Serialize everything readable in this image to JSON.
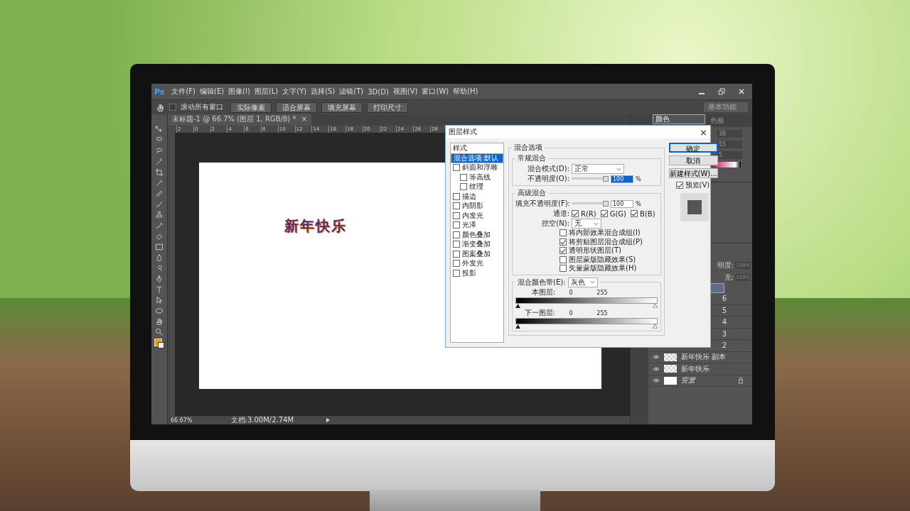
{
  "menubar": {
    "logo": "Ps",
    "menus": [
      "文件(F)",
      "编辑(E)",
      "图像(I)",
      "图层(L)",
      "文字(Y)",
      "选择(S)",
      "滤镜(T)",
      "3D(D)",
      "视图(V)",
      "窗口(W)",
      "帮助(H)"
    ]
  },
  "options_bar": {
    "scroll_all": {
      "label": "滚动所有窗口",
      "checked": false
    },
    "buttons": [
      "实际像素",
      "适合屏幕",
      "填充屏幕",
      "打印尺寸"
    ],
    "workspace": "基本功能"
  },
  "document": {
    "tab": "未标题-1 @ 66.7% (图层 1, RGB/8) *",
    "tab_close": "×",
    "ruler_labels": [
      "2",
      "0",
      "2",
      "4",
      "6",
      "8",
      "10",
      "12",
      "14",
      "16",
      "18",
      "20",
      "22",
      "24",
      "26",
      "28"
    ],
    "canvas_text": "新年快乐",
    "status": {
      "zoom": "66.67%",
      "doc_size": "文档:3.00M/2.74M"
    }
  },
  "panels": {
    "color_tabs": [
      {
        "label": "颜色",
        "selected": true
      },
      {
        "label": "色板",
        "selected": false
      }
    ],
    "color_values": [
      "38",
      "55",
      "5"
    ],
    "layers": {
      "opacity_label": "明度:",
      "opacity": "100%",
      "fill_label": "充:",
      "fill": "100%",
      "rows": [
        {
          "kind": "covered",
          "selected": true
        },
        {
          "kind": "covered",
          "name": "6",
          "selected": false
        },
        {
          "kind": "covered",
          "name": "5",
          "selected": false
        },
        {
          "kind": "covered",
          "name": "4",
          "selected": false
        },
        {
          "kind": "covered",
          "name": "3",
          "selected": false
        },
        {
          "kind": "covered",
          "name": "2",
          "selected": false
        },
        {
          "kind": "full",
          "name": "新年快乐 副本",
          "selected": false,
          "visible": true,
          "locked": false,
          "transparent": true
        },
        {
          "kind": "full",
          "name": "新年快乐",
          "selected": false,
          "visible": true,
          "locked": false,
          "transparent": true
        },
        {
          "kind": "full",
          "name": "背景",
          "selected": false,
          "visible": true,
          "locked": true,
          "transparent": false
        }
      ]
    }
  },
  "dialog": {
    "title": "图层样式",
    "close": "×",
    "styles_header": "样式",
    "styles": [
      {
        "label": "混合选项:默认",
        "kind": "plain",
        "selected": true
      },
      {
        "label": "斜面和浮雕",
        "kind": "check",
        "checked": false,
        "selected": false,
        "children": [
          {
            "label": "等高线",
            "kind": "check",
            "checked": false,
            "selected": false
          },
          {
            "label": "纹理",
            "kind": "check",
            "checked": false,
            "selected": false
          }
        ]
      },
      {
        "label": "描边",
        "kind": "check",
        "checked": false,
        "selected": false
      },
      {
        "label": "内阴影",
        "kind": "check",
        "checked": false,
        "selected": false
      },
      {
        "label": "内发光",
        "kind": "check",
        "checked": false,
        "selected": false
      },
      {
        "label": "光泽",
        "kind": "check",
        "checked": false,
        "selected": false
      },
      {
        "label": "颜色叠加",
        "kind": "check",
        "checked": false,
        "selected": false
      },
      {
        "label": "渐变叠加",
        "kind": "check",
        "checked": false,
        "selected": false
      },
      {
        "label": "图案叠加",
        "kind": "check",
        "checked": false,
        "selected": false
      },
      {
        "label": "外发光",
        "kind": "check",
        "checked": false,
        "selected": false
      },
      {
        "label": "投影",
        "kind": "check",
        "checked": false,
        "selected": false
      }
    ],
    "blend_options": {
      "title": "混合选项",
      "general": {
        "title": "常规混合",
        "mode_label": "混合模式(D):",
        "mode": "正常",
        "opacity": {
          "label": "不透明度(O):",
          "level": 1,
          "value": "100",
          "highlighted": true,
          "unit": "%"
        }
      },
      "advanced": {
        "title": "高级混合",
        "fill": {
          "label": "填充不透明度(F):",
          "level": 1,
          "value": "100",
          "highlighted": false,
          "unit": "%"
        },
        "channels_label": "通道:",
        "channels": [
          {
            "label": "R(R)",
            "checked": true
          },
          {
            "label": "G(G)",
            "checked": true
          },
          {
            "label": "B(B)",
            "checked": true
          }
        ],
        "knockout_label": "挖空(N):",
        "knockout": "无",
        "options": [
          {
            "label": "将内部效果混合成组(I)",
            "checked": false
          },
          {
            "label": "将剪贴图层混合成组(P)",
            "checked": true
          },
          {
            "label": "透明形状图层(T)",
            "checked": true
          },
          {
            "label": "图层蒙版隐藏效果(S)",
            "checked": false
          },
          {
            "label": "矢量蒙版隐藏效果(H)",
            "checked": false
          }
        ]
      },
      "blend_if": {
        "label": "混合颜色带(E):",
        "value": "灰色",
        "bands": [
          {
            "label": "本图层:",
            "low": "0",
            "high": "255"
          },
          {
            "label": "下一图层:",
            "low": "0",
            "high": "255"
          }
        ]
      }
    },
    "buttons": [
      {
        "label": "确定",
        "default": true
      },
      {
        "label": "取消",
        "default": false
      },
      {
        "label": "新建样式(W)...",
        "default": false
      }
    ],
    "preview": {
      "label": "预览(V)",
      "checked": true
    }
  }
}
